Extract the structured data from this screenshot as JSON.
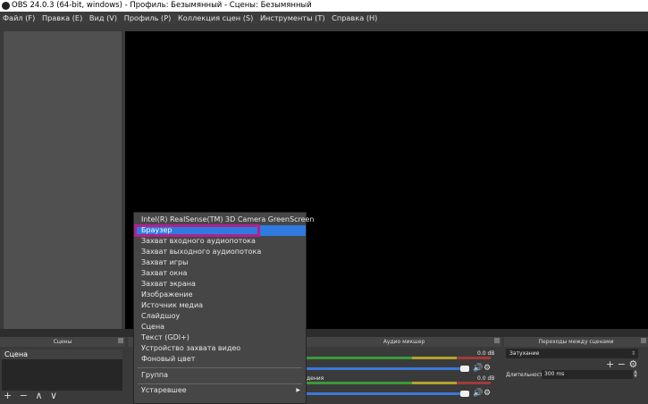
{
  "window": {
    "title": "OBS 24.0.3 (64-bit, windows) - Профиль: Безымянный - Сцены: Безымянный"
  },
  "menubar": [
    "Файл (F)",
    "Правка (E)",
    "Вид (V)",
    "Профиль (P)",
    "Коллекция сцен (S)",
    "Инструменты (T)",
    "Справка (H)"
  ],
  "scenes": {
    "title": "Сцены",
    "items": [
      "Сцена"
    ],
    "toolbar": [
      "+",
      "−",
      "∧",
      "∨"
    ]
  },
  "context_menu": {
    "items": [
      "Intel(R) RealSense(TM) 3D Camera GreenScreen",
      "Браузер",
      "Захват входного аудиопотока",
      "Захват выходного аудиопотока",
      "Захват игры",
      "Захват окна",
      "Захват экрана",
      "Изображение",
      "Источник медиа",
      "Слайдшоу",
      "Сцена",
      "Текст (GDI+)",
      "Устройство захвата видео",
      "Фоновый цвет"
    ],
    "selected_index": 1,
    "extra_items": [
      "Группа",
      "Устаревшее"
    ]
  },
  "audio_mixer": {
    "title": "Аудио микшер",
    "tracks": [
      {
        "label": "",
        "db": "0.0 dB",
        "volume": 1.0
      },
      {
        "label": "дения",
        "db": "0.0 dB",
        "volume": 1.0
      }
    ]
  },
  "transitions": {
    "title": "Переходы между сценами",
    "selected": "Затухание",
    "tools": [
      "+",
      "−"
    ],
    "duration_label": "Длительность",
    "duration_value": "300 ms"
  },
  "colors": {
    "accent": "#2f7be0",
    "highlight": "#b0228c"
  }
}
